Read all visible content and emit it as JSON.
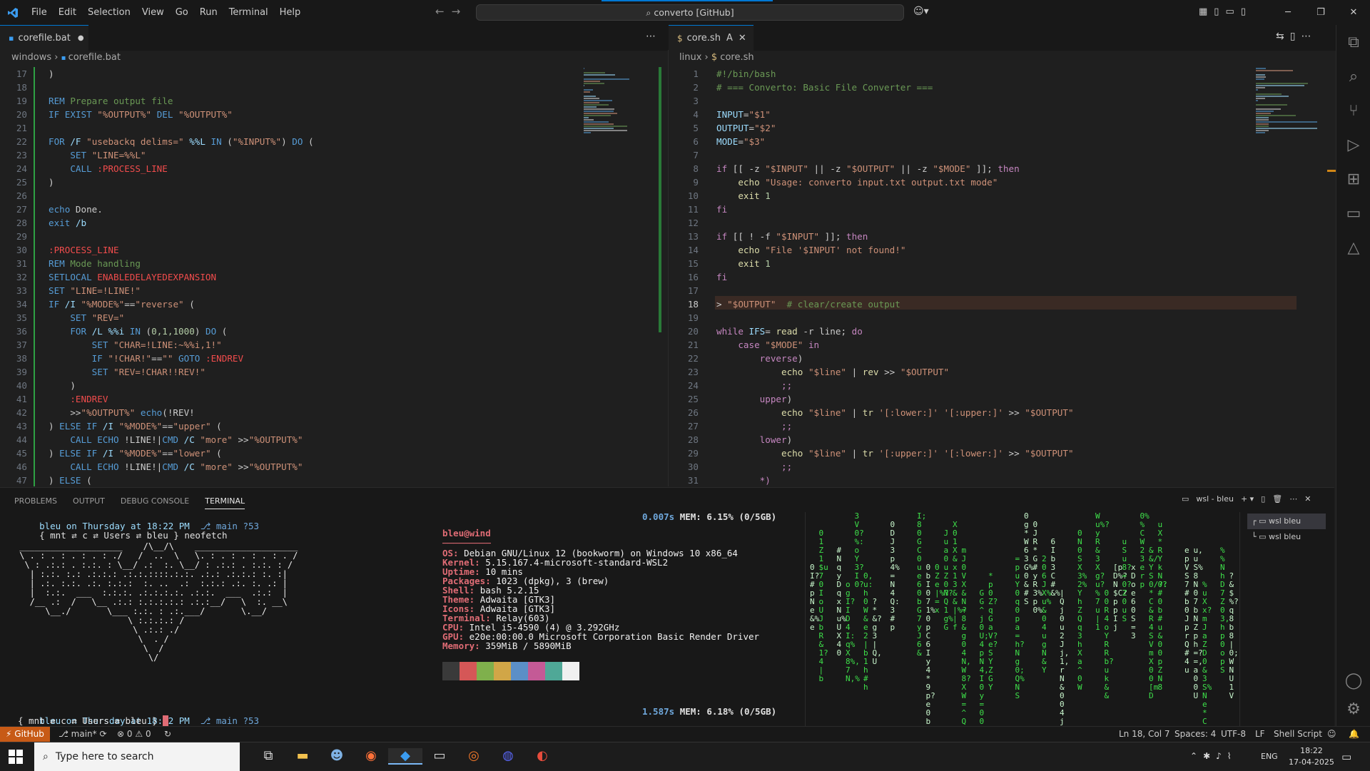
{
  "menu": {
    "items": [
      "File",
      "Edit",
      "Selection",
      "View",
      "Go",
      "Run",
      "Terminal",
      "Help"
    ]
  },
  "search": {
    "label": "converto [GitHub]"
  },
  "left_tab": {
    "label": "corefile.bat"
  },
  "right_tab": {
    "label": "core.sh",
    "badge": "A"
  },
  "left_breadcrumb": {
    "folder": "windows",
    "file": "corefile.bat"
  },
  "right_breadcrumb": {
    "folder": "linux",
    "file": "core.sh"
  },
  "panel": {
    "tabs": [
      "PROBLEMS",
      "OUTPUT",
      "DEBUG CONSOLE",
      "TERMINAL"
    ],
    "terminal_name": "wsl - bleu",
    "list": [
      "wsl bleu",
      "wsl bleu"
    ]
  },
  "status": {
    "github": "GitHub",
    "branch": "main*",
    "problems": "0",
    "warnings": "0",
    "position": "Ln 18, Col 7",
    "spaces": "Spaces: 4",
    "encoding": "UTF-8",
    "eol": "LF",
    "lang": "Shell Script"
  },
  "taskbar": {
    "search_placeholder": "Type here to search",
    "time": "18:22",
    "date": "17-04-2025",
    "lang": "ENG"
  },
  "neofetch": {
    "prompt1": "bleu on Thursday at 18:22 PM",
    "branch": "main",
    "count": "?53",
    "path": "{ mnt ⇄ c ⇄ Users ⇄ bleu }",
    "cmd": "neofetch",
    "time1": "0.007s",
    "mem1": "MEM: 6.15% (0/5GB)",
    "time2": "1.587s",
    "mem2": "MEM: 6.18% (0/5GB)",
    "user": "bleu@wind",
    "info": [
      [
        "OS",
        "Debian GNU/Linux 12 (bookworm) on Windows 10 x86_64"
      ],
      [
        "Kernel",
        "5.15.167.4-microsoft-standard-WSL2"
      ],
      [
        "Uptime",
        "10 mins"
      ],
      [
        "Packages",
        "1023 (dpkg), 3 (brew)"
      ],
      [
        "Shell",
        "bash 5.2.15"
      ],
      [
        "Theme",
        "Adwaita [GTK3]"
      ],
      [
        "Icons",
        "Adwaita [GTK3]"
      ],
      [
        "Terminal",
        "Relay(603)"
      ],
      [
        "CPU",
        "Intel i5-4590 (4) @ 3.292GHz"
      ],
      [
        "GPU",
        "e20e:00:00.0 Microsoft Corporation Basic Render Driver"
      ],
      [
        "Memory",
        "359MiB / 5890MiB"
      ]
    ],
    "palette": [
      "#3a3a3a",
      "#d55757",
      "#7fb04c",
      "#d1a647",
      "#5b8fc7",
      "#c45a96",
      "#4fa897",
      "#f0f0f0"
    ]
  },
  "left_code": [
    {
      "n": "17",
      "t": "<span class='p'>)</span>"
    },
    {
      "n": "18",
      "t": ""
    },
    {
      "n": "19",
      "t": "<span class='k'>REM</span> <span class='c'>Prepare output file</span>"
    },
    {
      "n": "20",
      "t": "<span class='k'>IF EXIST</span> <span class='s'>\"%OUTPUT%\"</span> <span class='k'>DEL</span> <span class='s'>\"%OUTPUT%\"</span>"
    },
    {
      "n": "21",
      "t": ""
    },
    {
      "n": "22",
      "t": "<span class='k'>FOR</span> <span class='v'>/F</span> <span class='s'>\"usebackq delims=\"</span> <span class='v'>%%L</span> <span class='k'>IN</span> (<span class='s'>\"%INPUT%\"</span>) <span class='k'>DO</span> ("
    },
    {
      "n": "23",
      "t": "    <span class='k'>SET</span> <span class='s'>\"LINE=%%L\"</span>"
    },
    {
      "n": "24",
      "t": "    <span class='k'>CALL</span> <span class='r'>:PROCESS_LINE</span>"
    },
    {
      "n": "25",
      "t": "<span class='p'>)</span>"
    },
    {
      "n": "26",
      "t": ""
    },
    {
      "n": "27",
      "t": "<span class='k'>echo</span> Done."
    },
    {
      "n": "28",
      "t": "<span class='k'>exit</span> <span class='v'>/b</span>"
    },
    {
      "n": "29",
      "t": ""
    },
    {
      "n": "30",
      "t": "<span class='r'>:PROCESS_LINE</span>"
    },
    {
      "n": "31",
      "t": "<span class='k'>REM</span> <span class='c'>Mode handling</span>"
    },
    {
      "n": "32",
      "t": "<span class='k'>SETLOCAL</span> <span class='r'>ENABLEDELAYEDEXPANSION</span>"
    },
    {
      "n": "33",
      "t": "<span class='k'>SET</span> <span class='s'>\"LINE=!LINE!\"</span>"
    },
    {
      "n": "34",
      "t": "<span class='k'>IF</span> <span class='v'>/I</span> <span class='s'>\"%MODE%\"</span>==<span class='s'>\"reverse\"</span> ("
    },
    {
      "n": "35",
      "t": "    <span class='k'>SET</span> <span class='s'>\"REV=\"</span>"
    },
    {
      "n": "36",
      "t": "    <span class='k'>FOR</span> <span class='v'>/L</span> <span class='v'>%%i</span> <span class='k'>IN</span> (<span class='n'>0,1,1000</span>) <span class='k'>DO</span> ("
    },
    {
      "n": "37",
      "t": "        <span class='k'>SET</span> <span class='s'>\"CHAR=!LINE:~%%i,1!\"</span>"
    },
    {
      "n": "38",
      "t": "        <span class='k'>IF</span> <span class='s'>\"!CHAR!\"</span>==<span class='s'>\"\"</span> <span class='k'>GOTO</span> <span class='r'>:ENDREV</span>"
    },
    {
      "n": "39",
      "t": "        <span class='k'>SET</span> <span class='s'>\"REV=!CHAR!!REV!\"</span>"
    },
    {
      "n": "40",
      "t": "    <span class='p'>)</span>"
    },
    {
      "n": "41",
      "t": "    <span class='r'>:ENDREV</span>"
    },
    {
      "n": "42",
      "t": "    >><span class='s'>\"%OUTPUT%\"</span> <span class='k'>echo</span>(!REV!"
    },
    {
      "n": "43",
      "t": ") <span class='k'>ELSE IF</span> <span class='v'>/I</span> <span class='s'>\"%MODE%\"</span>==<span class='s'>\"upper\"</span> ("
    },
    {
      "n": "44",
      "t": "    <span class='k'>CALL ECHO</span> !LINE!|<span class='k'>CMD</span> <span class='v'>/C</span> <span class='s'>\"more\"</span> >><span class='s'>\"%OUTPUT%\"</span>"
    },
    {
      "n": "45",
      "t": ") <span class='k'>ELSE IF</span> <span class='v'>/I</span> <span class='s'>\"%MODE%\"</span>==<span class='s'>\"lower\"</span> ("
    },
    {
      "n": "46",
      "t": "    <span class='k'>CALL ECHO</span> !LINE!|<span class='k'>CMD</span> <span class='v'>/C</span> <span class='s'>\"more\"</span> >><span class='s'>\"%OUTPUT%\"</span>"
    },
    {
      "n": "47",
      "t": ") <span class='k'>ELSE</span> ("
    }
  ],
  "right_code": [
    {
      "n": "1",
      "t": "<span class='c'>#!/bin/bash</span>"
    },
    {
      "n": "2",
      "t": "<span class='c'># === Converto: Basic File Converter ===</span>"
    },
    {
      "n": "3",
      "t": ""
    },
    {
      "n": "4",
      "t": "<span class='v'>INPUT</span>=<span class='s'>\"$1\"</span>"
    },
    {
      "n": "5",
      "t": "<span class='v'>OUTPUT</span>=<span class='s'>\"$2\"</span>"
    },
    {
      "n": "6",
      "t": "<span class='v'>MODE</span>=<span class='s'>\"$3\"</span>"
    },
    {
      "n": "7",
      "t": ""
    },
    {
      "n": "8",
      "t": "<span class='pk'>if</span> [[ -z <span class='s'>\"$INPUT\"</span> || -z <span class='s'>\"$OUTPUT\"</span> || -z <span class='s'>\"$MODE\"</span> ]]; <span class='pk'>then</span>"
    },
    {
      "n": "9",
      "t": "    <span class='f'>echo</span> <span class='s'>\"Usage: converto input.txt output.txt mode\"</span>"
    },
    {
      "n": "10",
      "t": "    <span class='f'>exit</span> <span class='n'>1</span>"
    },
    {
      "n": "11",
      "t": "<span class='pk'>fi</span>"
    },
    {
      "n": "12",
      "t": ""
    },
    {
      "n": "13",
      "t": "<span class='pk'>if</span> [[ ! -f <span class='s'>\"$INPUT\"</span> ]]; <span class='pk'>then</span>"
    },
    {
      "n": "14",
      "t": "    <span class='f'>echo</span> <span class='s'>\"File '$INPUT' not found!\"</span>"
    },
    {
      "n": "15",
      "t": "    <span class='f'>exit</span> <span class='n'>1</span>"
    },
    {
      "n": "16",
      "t": "<span class='pk'>fi</span>"
    },
    {
      "n": "17",
      "t": ""
    },
    {
      "n": "18",
      "t": "> <span class='s'>\"$OUTPUT\"</span>  <span class='c'># clear/create output</span>"
    },
    {
      "n": "19",
      "t": ""
    },
    {
      "n": "20",
      "t": "<span class='pk'>while</span> <span class='v'>IFS</span>= <span class='f'>read</span> -r line; <span class='pk'>do</span>"
    },
    {
      "n": "21",
      "t": "    <span class='pk'>case</span> <span class='s'>\"$MODE\"</span> <span class='pk'>in</span>"
    },
    {
      "n": "22",
      "t": "        <span class='pk'>reverse</span>)"
    },
    {
      "n": "23",
      "t": "            <span class='f'>echo</span> <span class='s'>\"$line\"</span> | <span class='f'>rev</span> >> <span class='s'>\"$OUTPUT\"</span>"
    },
    {
      "n": "24",
      "t": "            <span class='pk'>;;</span>"
    },
    {
      "n": "25",
      "t": "        <span class='pk'>upper</span>)"
    },
    {
      "n": "26",
      "t": "            <span class='f'>echo</span> <span class='s'>\"$line\"</span> | <span class='f'>tr</span> <span class='s'>'[:lower:]'</span> <span class='s'>'[:upper:]'</span> >> <span class='s'>\"$OUTPUT\"</span>"
    },
    {
      "n": "27",
      "t": "            <span class='pk'>;;</span>"
    },
    {
      "n": "28",
      "t": "        <span class='pk'>lower</span>)"
    },
    {
      "n": "29",
      "t": "            <span class='f'>echo</span> <span class='s'>\"$line\"</span> | <span class='f'>tr</span> <span class='s'>'[:upper:]'</span> <span class='s'>'[:lower:]'</span> >> <span class='s'>\"$OUTPUT\"</span>"
    },
    {
      "n": "30",
      "t": "            <span class='pk'>;;</span>"
    },
    {
      "n": "31",
      "t": "        <span class='pk'>*)</span>"
    }
  ],
  "bat_art": [
    " ____________________    /\\__/\\    ____________________",
    " \\ . : . : . : . : ./   /  ..  \\   \\. : . : . : . : . /",
    "  \\ : .:.: . :.:. : \\__/ .:  :. \\__/ : .:.: . :.:. : /",
    "   | :.:. :.: .:.:.: .:.:.::::.:.:. .:.: .:.:.: :. :|",
    "   | .:. :.:. .:. :.:.:  :. ..  .:  :.:.: .:. :. .: |",
    "   |  :.:.  ___  :.:.:. .:.:.:.:. .:.:.  ___  .:.:  |",
    "   /__ .:  /   \\__ .:.: :.:.:.:.: .:.:__/   \\  :. __\\",
    "      \\__./       \\___ :.:. : .:.___/       \\.__/",
    "                      \\ :.:.:.: /",
    "                       \\ .:.: ./",
    "                        \\  . /",
    "                         \\  /",
    "                          \\/"
  ],
  "matrix_cols": "Y3h1h$*  g0#0S0p  0XUS0u  1ZU%  kVX |q0W  :8&0Q?Rg  Q=&39;j0Ne  JC#I4GpD  Z?6?#G3  8b1ar?Nx  ^N  f0Q%eR  b?u&W4&  %%pu%%C  ,m[*bD0x  ,2pyu0=  4Nu%o  =7/?q"
}
